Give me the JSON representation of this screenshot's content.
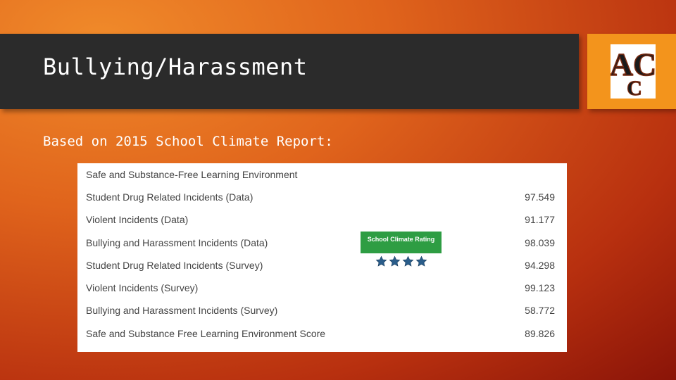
{
  "slide": {
    "title": "Bullying/Harassment",
    "subtitle": "Based on 2015 School Climate Report:"
  },
  "logo": {
    "letters": "AC",
    "icon": "school-logo-icon"
  },
  "report": {
    "header": "Safe and Substance-Free Learning Environment",
    "rows": [
      {
        "label": "Student Drug Related Incidents (Data)",
        "value": "97.549"
      },
      {
        "label": "Violent Incidents (Data)",
        "value": "91.177"
      },
      {
        "label": "Bullying and Harassment Incidents (Data)",
        "value": "98.039"
      },
      {
        "label": "Student Drug Related Incidents (Survey)",
        "value": "94.298"
      },
      {
        "label": "Violent Incidents (Survey)",
        "value": "99.123"
      },
      {
        "label": "Bullying and Harassment Incidents (Survey)",
        "value": "58.772"
      },
      {
        "label": "Safe and Substance Free Learning Environment Score",
        "value": "89.826"
      }
    ],
    "rating_badge": "School Climate Rating",
    "rating_stars": 4
  },
  "colors": {
    "title_bar": "#2b2b2b",
    "logo_tile": "#f3941c",
    "badge": "#2e9d43",
    "star": "#2a5d8a"
  }
}
